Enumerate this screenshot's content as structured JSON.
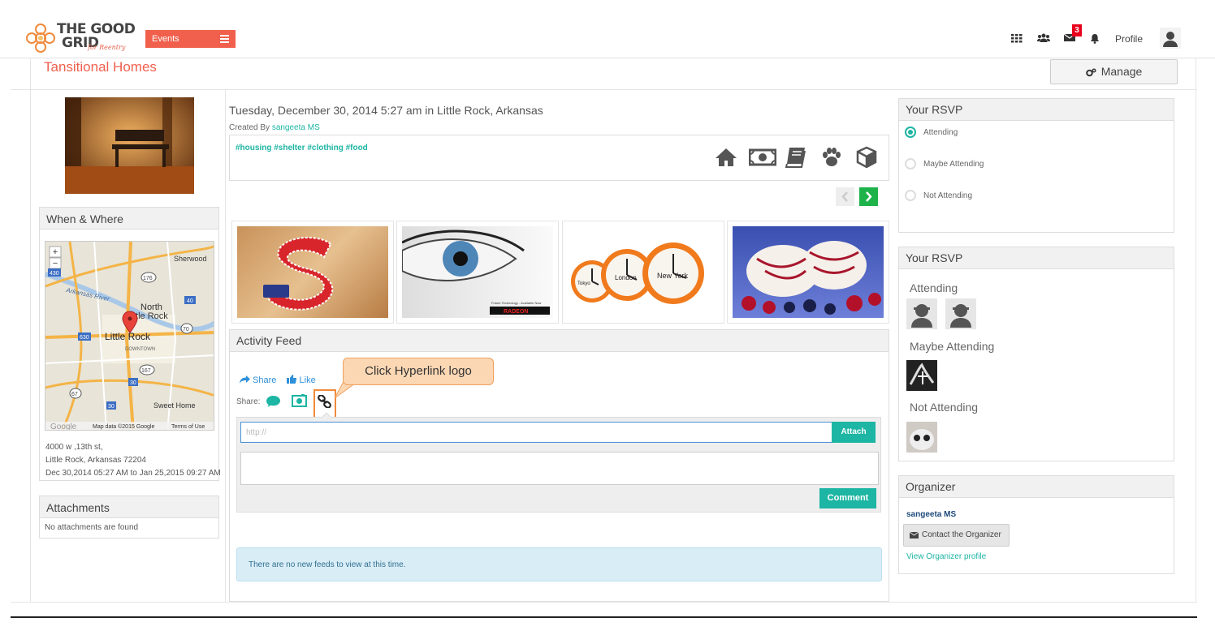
{
  "header": {
    "logo_line1": "THE GOOD",
    "logo_line2": "GRID",
    "logo_tagline": "for Reentry",
    "events_label": "Events",
    "messages_badge": "3",
    "profile_label": "Profile",
    "icons": [
      "grid-icon",
      "users-icon",
      "envelope-icon",
      "bell-icon",
      "user-avatar-icon"
    ]
  },
  "page": {
    "title": "Tansitional Homes",
    "manage_label": "Manage"
  },
  "left": {
    "when_where_title": "When & Where",
    "map_labels": {
      "sherwood": "Sherwood",
      "north_little_rock": "North",
      "north_little_rock2": "ttle Rock",
      "little_rock": "Little Rock",
      "downtown": "DOWNTOWN",
      "sweet_home": "Sweet Home",
      "arkansas_river": "Arkansas River",
      "footer": "Map data ©2015 Google",
      "terms": "Terms of Use",
      "google": "Google",
      "h430": "430",
      "h176": "176",
      "h40": "40",
      "h70": "70",
      "h167": "167",
      "h30": "30",
      "h30b": "30",
      "h67": "67",
      "h630": "630"
    },
    "address_line1": "4000 w ,13th st,",
    "address_line2": "Little Rock, Arkansas 72204",
    "date_range": "Dec 30,2014 05:27 AM to Jan 25,2015 09:27 AM",
    "attachments_title": "Attachments",
    "attachments_empty": "No attachments are found"
  },
  "event": {
    "date_line": "Tuesday, December 30, 2014 5:27 am in Little Rock, Arkansas",
    "created_by_label": "Created By",
    "created_by_name": "sangeeta MS",
    "tags": "#housing #shelter #clothing #food",
    "category_icons": [
      "home-icon",
      "money-icon",
      "book-icon",
      "paw-icon",
      "box-icon"
    ],
    "thumbnails": [
      "felt-letter-s-image",
      "eye-image",
      "alarm-clocks-image",
      "ice-cream-berries-image"
    ],
    "thumb_texts": {
      "eye_caption": "Future Technology - Available Now",
      "eye_brand": "RADEON",
      "clock_tokyo": "Tokyo",
      "clock_london": "London",
      "clock_newyork": "New York"
    }
  },
  "feed": {
    "title": "Activity Feed",
    "share_label": "Share",
    "like_label": "Like",
    "share_prefix": "Share:",
    "callout_text": "Click Hyperlink logo",
    "url_placeholder": "http://",
    "attach_label": "Attach",
    "comment_label": "Comment",
    "no_feeds_text": "There are no new feeds to view at this time."
  },
  "rsvp": {
    "title": "Your RSVP",
    "options": [
      {
        "label": "Attending",
        "selected": true
      },
      {
        "label": "Maybe Attending",
        "selected": false
      },
      {
        "label": "Not Attending",
        "selected": false
      }
    ]
  },
  "attendees": {
    "title": "Your RSVP",
    "attending_label": "Attending",
    "maybe_label": "Maybe Attending",
    "not_label": "Not Attending"
  },
  "organizer": {
    "title": "Organizer",
    "name": "sangeeta MS",
    "contact_label": "Contact the Organizer",
    "profile_link": "View Organizer profile"
  },
  "colors": {
    "accent": "#f0604d",
    "teal": "#1db5a3",
    "link_blue": "#2f8fd8",
    "callout_border": "#f08a3c"
  }
}
